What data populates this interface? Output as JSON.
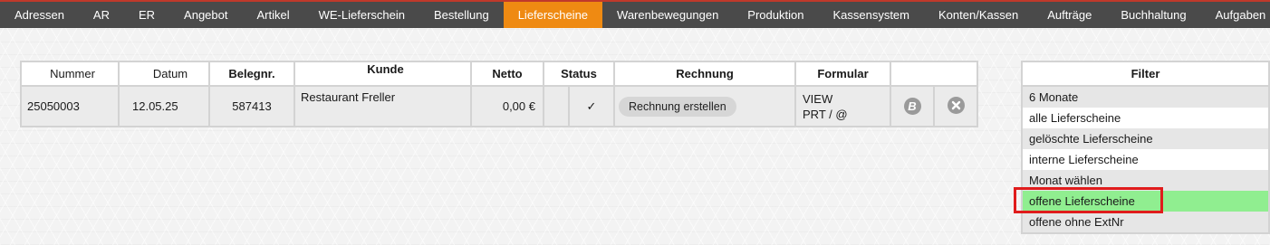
{
  "nav": {
    "tabs": [
      {
        "label": "Adressen",
        "active": false
      },
      {
        "label": "AR",
        "active": false
      },
      {
        "label": "ER",
        "active": false
      },
      {
        "label": "Angebot",
        "active": false
      },
      {
        "label": "Artikel",
        "active": false
      },
      {
        "label": "WE-Lieferschein",
        "active": false
      },
      {
        "label": "Bestellung",
        "active": false
      },
      {
        "label": "Lieferscheine",
        "active": true
      },
      {
        "label": "Warenbewegungen",
        "active": false
      },
      {
        "label": "Produktion",
        "active": false
      },
      {
        "label": "Kassensystem",
        "active": false
      },
      {
        "label": "Konten/Kassen",
        "active": false
      },
      {
        "label": "Aufträge",
        "active": false
      },
      {
        "label": "Buchhaltung",
        "active": false
      },
      {
        "label": "Aufgaben",
        "active": false
      }
    ],
    "accent_color": "#ef8a12"
  },
  "table": {
    "headers": {
      "nummer": "Nummer",
      "datum": "Datum",
      "belegnr": "Belegnr.",
      "kunde": "Kunde",
      "netto": "Netto",
      "status": "Status",
      "rechnung": "Rechnung",
      "formular": "Formular"
    },
    "row": {
      "nummer": "25050003",
      "datum": "12.05.25",
      "belegnr": "587413",
      "kunde": "Restaurant Freller",
      "netto": "0,00 €",
      "status_check": "✓",
      "rechnung_button": "Rechnung erstellen",
      "formular_line1": "VIEW",
      "formular_line2": "PRT / @",
      "b_icon_letter": "B"
    },
    "icons": {
      "b": "b-circle-icon",
      "x": "close-circle-icon"
    }
  },
  "filter": {
    "title": "Filter",
    "items": [
      "6 Monate",
      "alle Lieferscheine",
      "gelöschte Lieferscheine",
      "interne Lieferscheine",
      "Monat wählen",
      "offene Lieferscheine",
      "offene ohne ExtNr"
    ],
    "selected_index": 5,
    "selected_color": "#90ee90",
    "highlight_color": "#e01c1c"
  }
}
